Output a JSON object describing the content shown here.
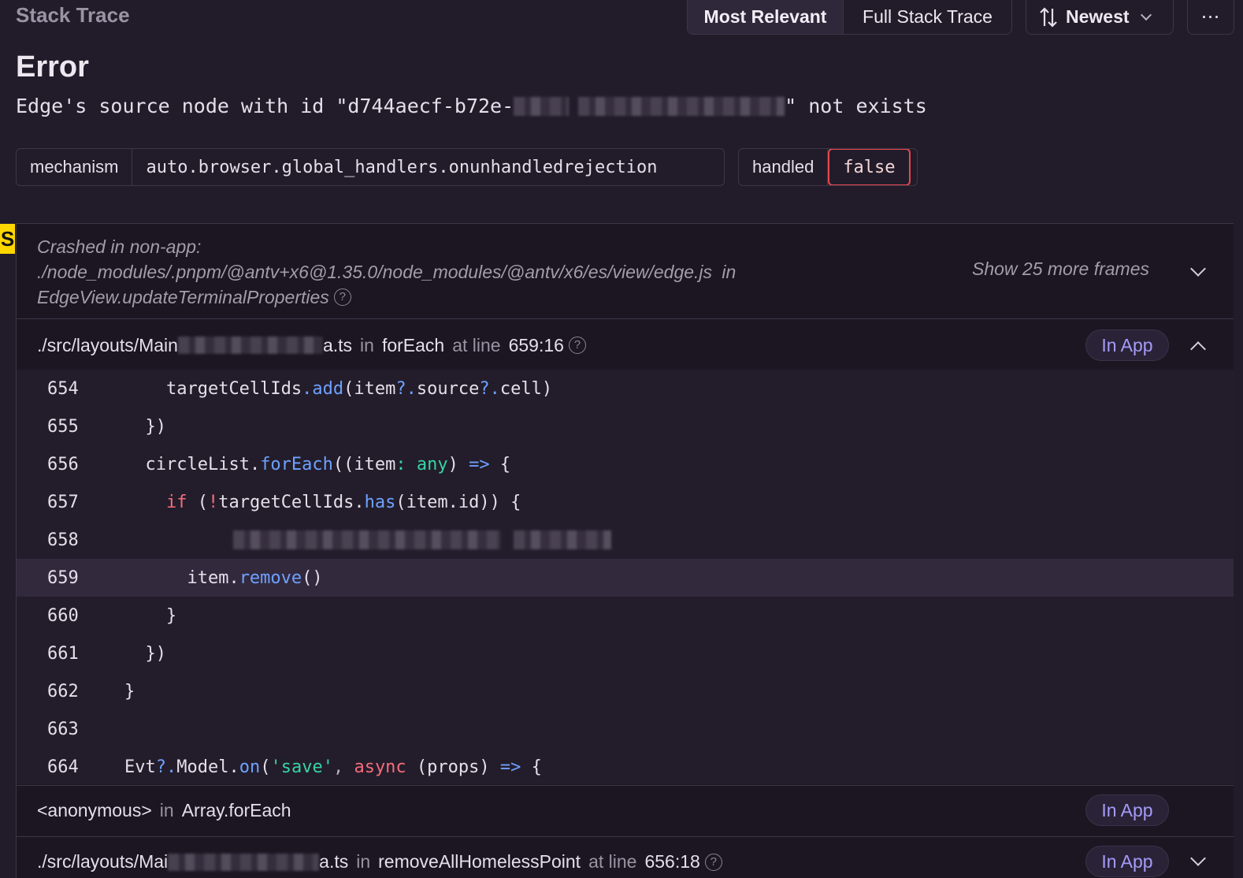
{
  "header": {
    "title": "Stack Trace",
    "tab_most_relevant": "Most Relevant",
    "tab_full_stack": "Full Stack Trace",
    "sort_label": "Newest",
    "more_label": "⋯"
  },
  "error": {
    "type": "Error",
    "message_prefix": "Edge's source node with id \"d744aecf-b72e-",
    "message_suffix": "\" not exists"
  },
  "tags": [
    {
      "key": "mechanism",
      "value": "auto.browser.global_handlers.onunhandledrejection"
    },
    {
      "key": "handled",
      "value": "false"
    }
  ],
  "crash": {
    "label": "Crashed in non-app:",
    "path": "./node_modules/.pnpm/@antv+x6@1.35.0/node_modules/@antv/x6/es/view/edge.js",
    "in": "in",
    "function": "EdgeView.updateTerminalProperties",
    "help": "?",
    "show_more": "Show 25 more frames"
  },
  "frames": [
    {
      "file_prefix": "./src/layouts/Main",
      "file_suffix": "a.ts",
      "in": "in",
      "function": "forEach",
      "at_line_label": "at line",
      "line": "659:16",
      "help": "?",
      "badge": "In App"
    },
    {
      "file_prefix": "<anonymous>",
      "file_suffix": "",
      "in": "in",
      "function": "Array.forEach",
      "badge": "In App"
    },
    {
      "file_prefix": "./src/layouts/Mai",
      "file_suffix": "a.ts",
      "in": "in",
      "function": "removeAllHomelessPoint",
      "at_line_label": "at line",
      "line": "656:18",
      "help": "?",
      "badge": "In App"
    }
  ],
  "code": {
    "line_numbers": [
      "654",
      "655",
      "656",
      "657",
      "658",
      "659",
      "660",
      "661",
      "662",
      "663",
      "664"
    ],
    "highlighted_line": "659",
    "l654": {
      "indent": "        ",
      "a": "targetCellIds",
      "b": ".",
      "c": "add",
      "d": "(item",
      "e": "?.",
      "f": "source",
      "g": "?.",
      "h": "cell)"
    },
    "l655": "      })",
    "l656": {
      "indent": "      ",
      "a": "circleList",
      "b": ".",
      "c": "forEach",
      "d": "((item",
      "e": ":",
      "f": " any",
      "g": ")",
      "h": " =>",
      "i": " {"
    },
    "l657": {
      "indent": "        ",
      "a": "if",
      "b": " (",
      "c": "!",
      "d": "targetCellIds",
      "e": ".",
      "f": "has",
      "g": "(item.id)) {"
    },
    "l659": {
      "indent": "          ",
      "a": "item",
      "b": ".",
      "c": "remove",
      "d": "()"
    },
    "l660": "        }",
    "l661": "      })",
    "l662": "    }",
    "l663": "",
    "l664": {
      "indent": "    ",
      "a": "Evt",
      "b": "?.",
      "c": "Model",
      "d": ".",
      "e": "on",
      "f": "(",
      "g": "'save'",
      "h": ",",
      "i": " async",
      "j": " (props)",
      "k": " =>",
      "l": " {"
    }
  }
}
